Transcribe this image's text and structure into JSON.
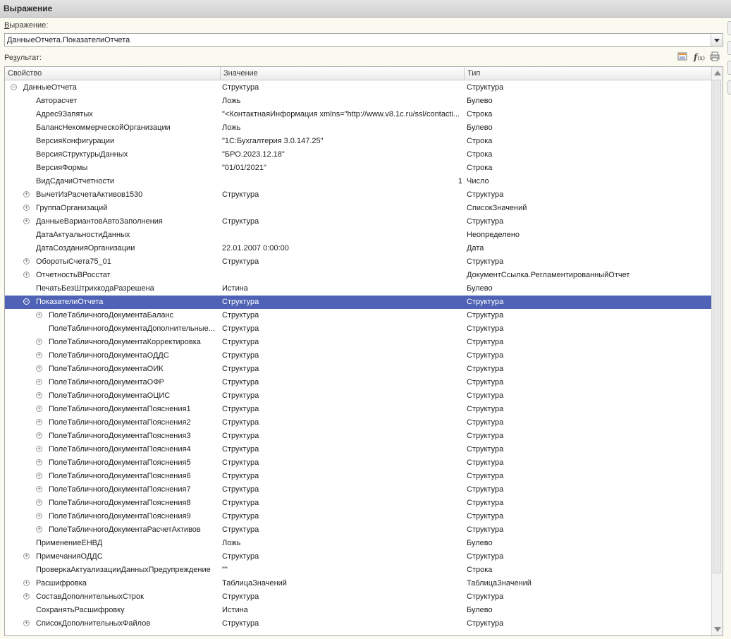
{
  "window": {
    "title": "Выражение"
  },
  "expression": {
    "label_pre": "",
    "label_u": "В",
    "label_post": "ыражение:",
    "value": "ДанныеОтчета.ПоказателиОтчета"
  },
  "result": {
    "label_pre": "Ре",
    "label_u": "з",
    "label_post": "ультат:"
  },
  "toolbar": {
    "icons": [
      "structure-icon",
      "function-icon",
      "print-icon"
    ],
    "fx_label": "f",
    "fx_sub": "(x)"
  },
  "table": {
    "columns": [
      "Свойство",
      "Значение",
      "Тип"
    ],
    "rows": [
      {
        "level": 0,
        "toggle": "collapse",
        "name": "ДанныеОтчета",
        "value": "Структура",
        "type": "Структура"
      },
      {
        "level": 1,
        "toggle": "",
        "name": "Авторасчет",
        "value": "Ложь",
        "type": "Булево"
      },
      {
        "level": 1,
        "toggle": "",
        "name": "Адрес9Запятых",
        "value": "\"<КонтактнаяИнформация xmlns=\"http://www.v8.1c.ru/ssl/contacti...",
        "type": "Строка"
      },
      {
        "level": 1,
        "toggle": "",
        "name": "БалансНекоммерческойОрганизации",
        "value": "Ложь",
        "type": "Булево"
      },
      {
        "level": 1,
        "toggle": "",
        "name": "ВерсияКонфигурации",
        "value": "\"1С:Бухгалтерия 3.0.147.25\"",
        "type": "Строка"
      },
      {
        "level": 1,
        "toggle": "",
        "name": "ВерсияСтруктурыДанных",
        "value": "\"БРО.2023.12.18\"",
        "type": "Строка"
      },
      {
        "level": 1,
        "toggle": "",
        "name": "ВерсияФормы",
        "value": "\"01/01/2021\"",
        "type": "Строка"
      },
      {
        "level": 1,
        "toggle": "",
        "name": "ВидСдачиОтчетности",
        "value": "1",
        "type": "Число",
        "align": "right"
      },
      {
        "level": 1,
        "toggle": "expand",
        "name": "ВычетИзРасчетаАктивов1530",
        "value": "Структура",
        "type": "Структура"
      },
      {
        "level": 1,
        "toggle": "expand",
        "name": "ГруппаОрганизаций",
        "value": "",
        "type": "СписокЗначений"
      },
      {
        "level": 1,
        "toggle": "expand",
        "name": "ДанныеВариантовАвтоЗаполнения",
        "value": "Структура",
        "type": "Структура"
      },
      {
        "level": 1,
        "toggle": "",
        "name": "ДатаАктуальностиДанных",
        "value": "",
        "type": "Неопределено"
      },
      {
        "level": 1,
        "toggle": "",
        "name": "ДатаСозданияОрганизации",
        "value": "22.01.2007 0:00:00",
        "type": "Дата"
      },
      {
        "level": 1,
        "toggle": "expand",
        "name": "ОборотыСчета75_01",
        "value": "Структура",
        "type": "Структура"
      },
      {
        "level": 1,
        "toggle": "expand",
        "name": "ОтчетностьВРосстат",
        "value": "",
        "type": "ДокументСсылка.РегламентированныйОтчет"
      },
      {
        "level": 1,
        "toggle": "",
        "name": "ПечатьБезШтрихкодаРазрешена",
        "value": "Истина",
        "type": "Булево"
      },
      {
        "level": 1,
        "toggle": "collapse",
        "name": "ПоказателиОтчета",
        "value": "Структура",
        "type": "Структура",
        "selected": true
      },
      {
        "level": 2,
        "toggle": "expand",
        "name": "ПолеТабличногоДокументаБаланс",
        "value": "Структура",
        "type": "Структура"
      },
      {
        "level": 2,
        "toggle": "",
        "name": "ПолеТабличногоДокументаДополнительные...",
        "value": "Структура",
        "type": "Структура"
      },
      {
        "level": 2,
        "toggle": "expand",
        "name": "ПолеТабличногоДокументаКорректировка",
        "value": "Структура",
        "type": "Структура"
      },
      {
        "level": 2,
        "toggle": "expand",
        "name": "ПолеТабличногоДокументаОДДС",
        "value": "Структура",
        "type": "Структура"
      },
      {
        "level": 2,
        "toggle": "expand",
        "name": "ПолеТабличногоДокументаОИК",
        "value": "Структура",
        "type": "Структура"
      },
      {
        "level": 2,
        "toggle": "expand",
        "name": "ПолеТабличногоДокументаОФР",
        "value": "Структура",
        "type": "Структура"
      },
      {
        "level": 2,
        "toggle": "expand",
        "name": "ПолеТабличногоДокументаОЦИС",
        "value": "Структура",
        "type": "Структура"
      },
      {
        "level": 2,
        "toggle": "expand",
        "name": "ПолеТабличногоДокументаПояснения1",
        "value": "Структура",
        "type": "Структура"
      },
      {
        "level": 2,
        "toggle": "expand",
        "name": "ПолеТабличногоДокументаПояснения2",
        "value": "Структура",
        "type": "Структура"
      },
      {
        "level": 2,
        "toggle": "expand",
        "name": "ПолеТабличногоДокументаПояснения3",
        "value": "Структура",
        "type": "Структура"
      },
      {
        "level": 2,
        "toggle": "expand",
        "name": "ПолеТабличногоДокументаПояснения4",
        "value": "Структура",
        "type": "Структура"
      },
      {
        "level": 2,
        "toggle": "expand",
        "name": "ПолеТабличногоДокументаПояснения5",
        "value": "Структура",
        "type": "Структура"
      },
      {
        "level": 2,
        "toggle": "expand",
        "name": "ПолеТабличногоДокументаПояснения6",
        "value": "Структура",
        "type": "Структура"
      },
      {
        "level": 2,
        "toggle": "expand",
        "name": "ПолеТабличногоДокументаПояснения7",
        "value": "Структура",
        "type": "Структура"
      },
      {
        "level": 2,
        "toggle": "expand",
        "name": "ПолеТабличногоДокументаПояснения8",
        "value": "Структура",
        "type": "Структура"
      },
      {
        "level": 2,
        "toggle": "expand",
        "name": "ПолеТабличногоДокументаПояснения9",
        "value": "Структура",
        "type": "Структура"
      },
      {
        "level": 2,
        "toggle": "expand",
        "name": "ПолеТабличногоДокументаРасчетАктивов",
        "value": "Структура",
        "type": "Структура"
      },
      {
        "level": 1,
        "toggle": "",
        "name": "ПрименениеЕНВД",
        "value": "Ложь",
        "type": "Булево"
      },
      {
        "level": 1,
        "toggle": "expand",
        "name": "ПримечанияОДДС",
        "value": "Структура",
        "type": "Структура"
      },
      {
        "level": 1,
        "toggle": "",
        "name": "ПроверкаАктуализацииДанныхПредупреждение",
        "value": "\"\"",
        "type": "Строка"
      },
      {
        "level": 1,
        "toggle": "expand",
        "name": "Расшифровка",
        "value": "ТаблицаЗначений",
        "type": "ТаблицаЗначений"
      },
      {
        "level": 1,
        "toggle": "expand",
        "name": "СоставДополнительныхСтрок",
        "value": "Структура",
        "type": "Структура"
      },
      {
        "level": 1,
        "toggle": "",
        "name": "СохранятьРасшифровку",
        "value": "Истина",
        "type": "Булево"
      },
      {
        "level": 1,
        "toggle": "expand",
        "name": "СписокДополнительныхФайлов",
        "value": "Структура",
        "type": "Структура"
      }
    ]
  },
  "colors": {
    "selection": "#4f62b5",
    "background": "#fbfaf0"
  }
}
